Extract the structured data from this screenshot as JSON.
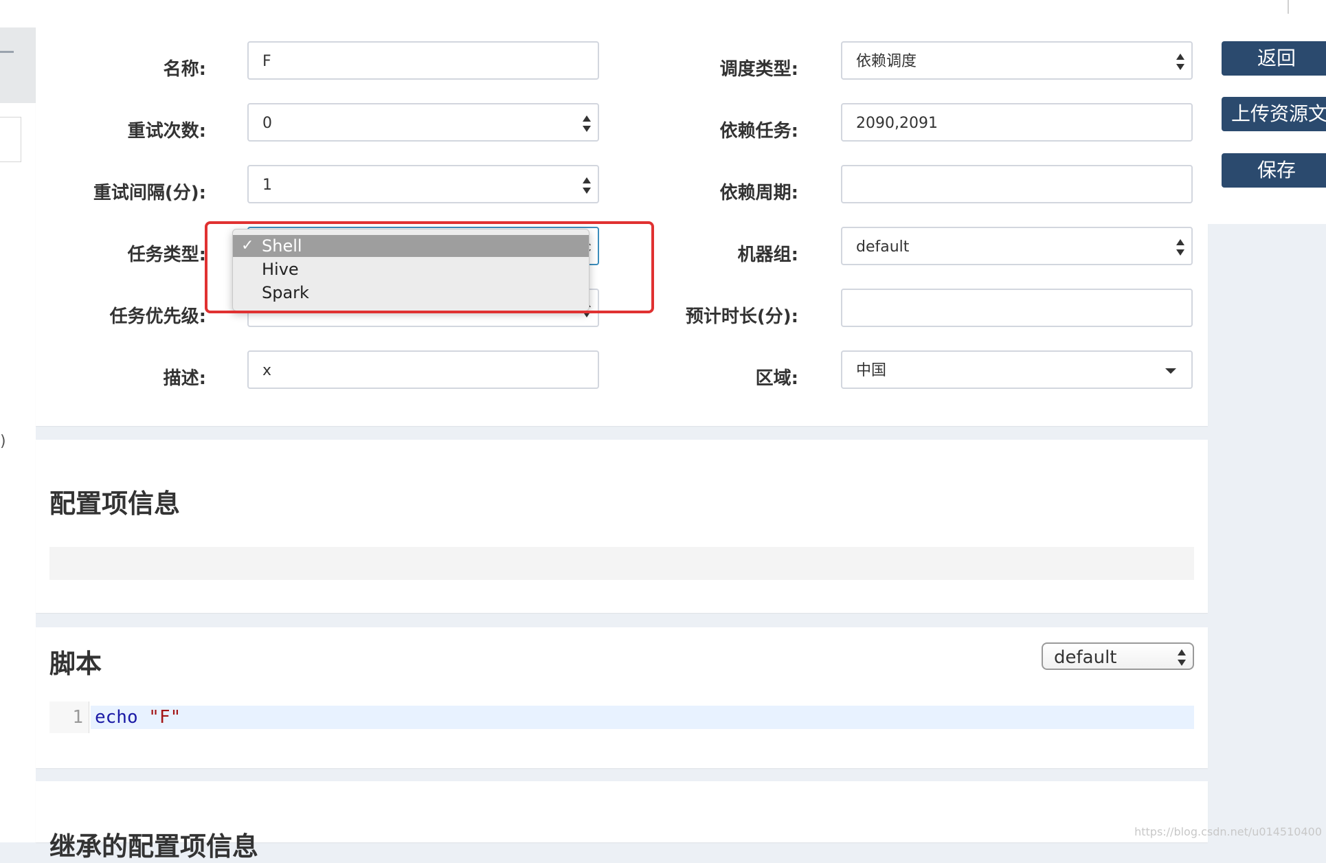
{
  "form": {
    "left": {
      "name_label": "名称:",
      "name_value": "F",
      "retry_count_label": "重试次数:",
      "retry_count_value": "0",
      "retry_interval_label": "重试间隔(分):",
      "retry_interval_value": "1",
      "task_type_label": "任务类型:",
      "task_priority_label": "任务优先级:",
      "task_priority_partial": "...",
      "desc_label": "描述:",
      "desc_value": "x"
    },
    "right": {
      "schedule_type_label": "调度类型:",
      "schedule_type_value": "依赖调度",
      "dep_task_label": "依赖任务:",
      "dep_task_value": "2090,2091",
      "dep_period_label": "依赖周期:",
      "dep_period_value": "",
      "machine_group_label": "机器组:",
      "machine_group_value": "default",
      "est_duration_label": "预计时长(分):",
      "est_duration_value": "",
      "region_label": "区域:",
      "region_value": "中国"
    },
    "task_type_dropdown": {
      "options": [
        "Shell",
        "Hive",
        "Spark"
      ],
      "selected": "Shell",
      "check_icon": "✓"
    }
  },
  "actions": {
    "back_label": "返回",
    "upload_label": "上传资源文",
    "save_label": "保存"
  },
  "sections": {
    "config_title": "配置项信息",
    "script_title": "脚本",
    "script_select_value": "default",
    "inherit_title": "继承的配置项信息"
  },
  "script": {
    "line_number": "1",
    "keyword": "echo",
    "string": "\"F\""
  },
  "watermark": "https://blog.csdn.net/u014510400"
}
